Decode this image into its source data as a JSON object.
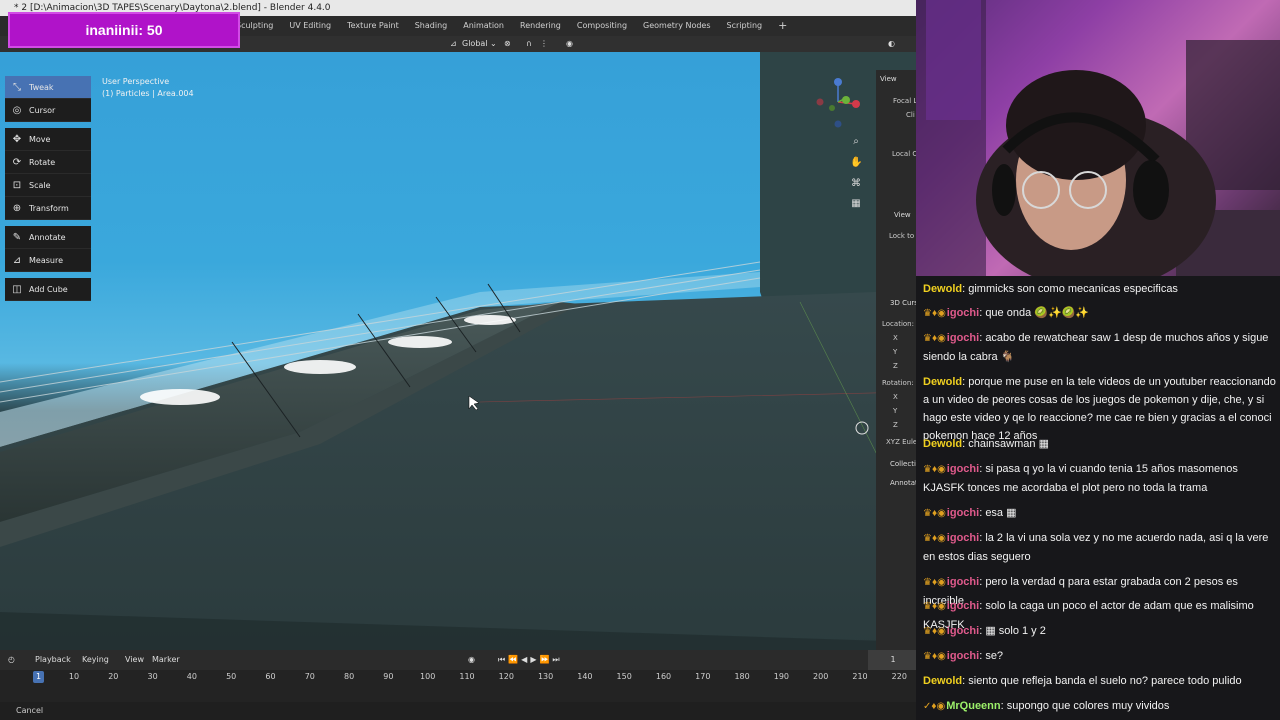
{
  "colors": {
    "accent": "#4772b3",
    "counter_bg": "#b013c9",
    "user_dewold": "#f0d020",
    "user_igochi": "#e05a8c",
    "user_mrqueenn": "#9cf06a"
  },
  "window": {
    "title": "* 2 [D:\\Animacion\\3D TAPES\\Scenary\\Daytona\\2.blend] - Blender 4.4.0"
  },
  "overlay": {
    "counter": "inaniinii: 50"
  },
  "workspace_tabs": [
    "Sculpting",
    "UV Editing",
    "Texture Paint",
    "Shading",
    "Animation",
    "Rendering",
    "Compositing",
    "Geometry Nodes",
    "Scripting",
    "+"
  ],
  "header": {
    "orientation": "Global"
  },
  "viewport": {
    "perspective": "User Perspective",
    "object": "(1) Particles | Area.004"
  },
  "tools": [
    {
      "label": "Tweak",
      "icon": "tweak-icon",
      "glyph": "⤡",
      "active": true
    },
    {
      "label": "Cursor",
      "icon": "cursor-icon",
      "glyph": "◎",
      "active": false
    },
    {
      "label": "Move",
      "icon": "move-icon",
      "glyph": "✥",
      "active": false
    },
    {
      "label": "Rotate",
      "icon": "rotate-icon",
      "glyph": "⟳",
      "active": false
    },
    {
      "label": "Scale",
      "icon": "scale-icon",
      "glyph": "⊡",
      "active": false
    },
    {
      "label": "Transform",
      "icon": "transform-icon",
      "glyph": "⊕",
      "active": false
    },
    {
      "label": "Annotate",
      "icon": "annotate-icon",
      "glyph": "✎",
      "active": false
    },
    {
      "label": "Measure",
      "icon": "measure-icon",
      "glyph": "⊿",
      "active": false
    },
    {
      "label": "Add Cube",
      "icon": "add-cube-icon",
      "glyph": "◫",
      "active": false
    }
  ],
  "npanel": {
    "view": "View",
    "focal": "Focal L",
    "clip": "Cli",
    "local_camera": "Local C",
    "view_section": "View",
    "lock_to": "Lock to",
    "cursor_section": "3D Curs",
    "location": "Location:",
    "x": "X",
    "y": "Y",
    "z": "Z",
    "rotation": "Rotation:",
    "rx": "X",
    "ry": "Y",
    "rz": "Z",
    "euler": "XYZ Eule",
    "collections": "Collecti",
    "annotations": "Annotat"
  },
  "timeline": {
    "menus": [
      "Playback",
      "Keying",
      "View",
      "Marker"
    ],
    "current_frame": "1",
    "playhead": "1",
    "ticks": [
      "10",
      "20",
      "30",
      "40",
      "50",
      "60",
      "70",
      "80",
      "90",
      "100",
      "110",
      "120",
      "130",
      "140",
      "150",
      "160",
      "170",
      "180",
      "190",
      "200",
      "210",
      "220"
    ]
  },
  "status": {
    "text": "Cancel"
  },
  "chat": [
    {
      "user": "Dewold",
      "color": "#f0d020",
      "badges": "",
      "text": "gimmicks son como mecanicas especificas"
    },
    {
      "user": "igochi",
      "color": "#e05a8c",
      "badges": "♛♦◉",
      "text": "que onda 🥝✨🥝✨"
    },
    {
      "user": "igochi",
      "color": "#e05a8c",
      "badges": "♛♦◉",
      "text": "acabo de rewatchear saw 1 desp de muchos años y sigue siendo la cabra 🐐"
    },
    {
      "user": "Dewold",
      "color": "#f0d020",
      "badges": "",
      "text": "porque me puse en la tele videos de un youtuber reaccionando a un video de peores cosas de los juegos de pokemon y dije, che, y si hago este video y qe lo reaccione? me cae re bien y gracias a el conoci pokemon hace 12 años"
    },
    {
      "user": "Dewold",
      "color": "#f0d020",
      "badges": "",
      "text": "chainsawman ▦"
    },
    {
      "user": "igochi",
      "color": "#e05a8c",
      "badges": "♛♦◉",
      "text": "si pasa q yo la vi cuando tenia 15 años masomenos KJASFK tonces me acordaba el plot pero no toda la trama"
    },
    {
      "user": "igochi",
      "color": "#e05a8c",
      "badges": "♛♦◉",
      "text": "esa ▦"
    },
    {
      "user": "igochi",
      "color": "#e05a8c",
      "badges": "♛♦◉",
      "text": "la 2 la vi una sola vez y no me acuerdo nada, asi q la vere en estos dias seguero"
    },
    {
      "user": "igochi",
      "color": "#e05a8c",
      "badges": "♛♦◉",
      "text": "pero la verdad q para estar grabada con 2 pesos es increible"
    },
    {
      "user": "igochi",
      "color": "#e05a8c",
      "badges": "♛♦◉",
      "text": "solo la caga un poco el actor de adam que es malisimo KASJFK"
    },
    {
      "user": "igochi",
      "color": "#e05a8c",
      "badges": "♛♦◉",
      "text": "▦ solo 1 y 2"
    },
    {
      "user": "igochi",
      "color": "#e05a8c",
      "badges": "♛♦◉",
      "text": "se?"
    },
    {
      "user": "Dewold",
      "color": "#f0d020",
      "badges": "",
      "text": "siento que refleja banda el suelo no? parece todo pulido"
    },
    {
      "user": "MrQueenn",
      "color": "#9cf06a",
      "badges": "✓♦◉",
      "text": "supongo que colores muy vividos"
    }
  ]
}
